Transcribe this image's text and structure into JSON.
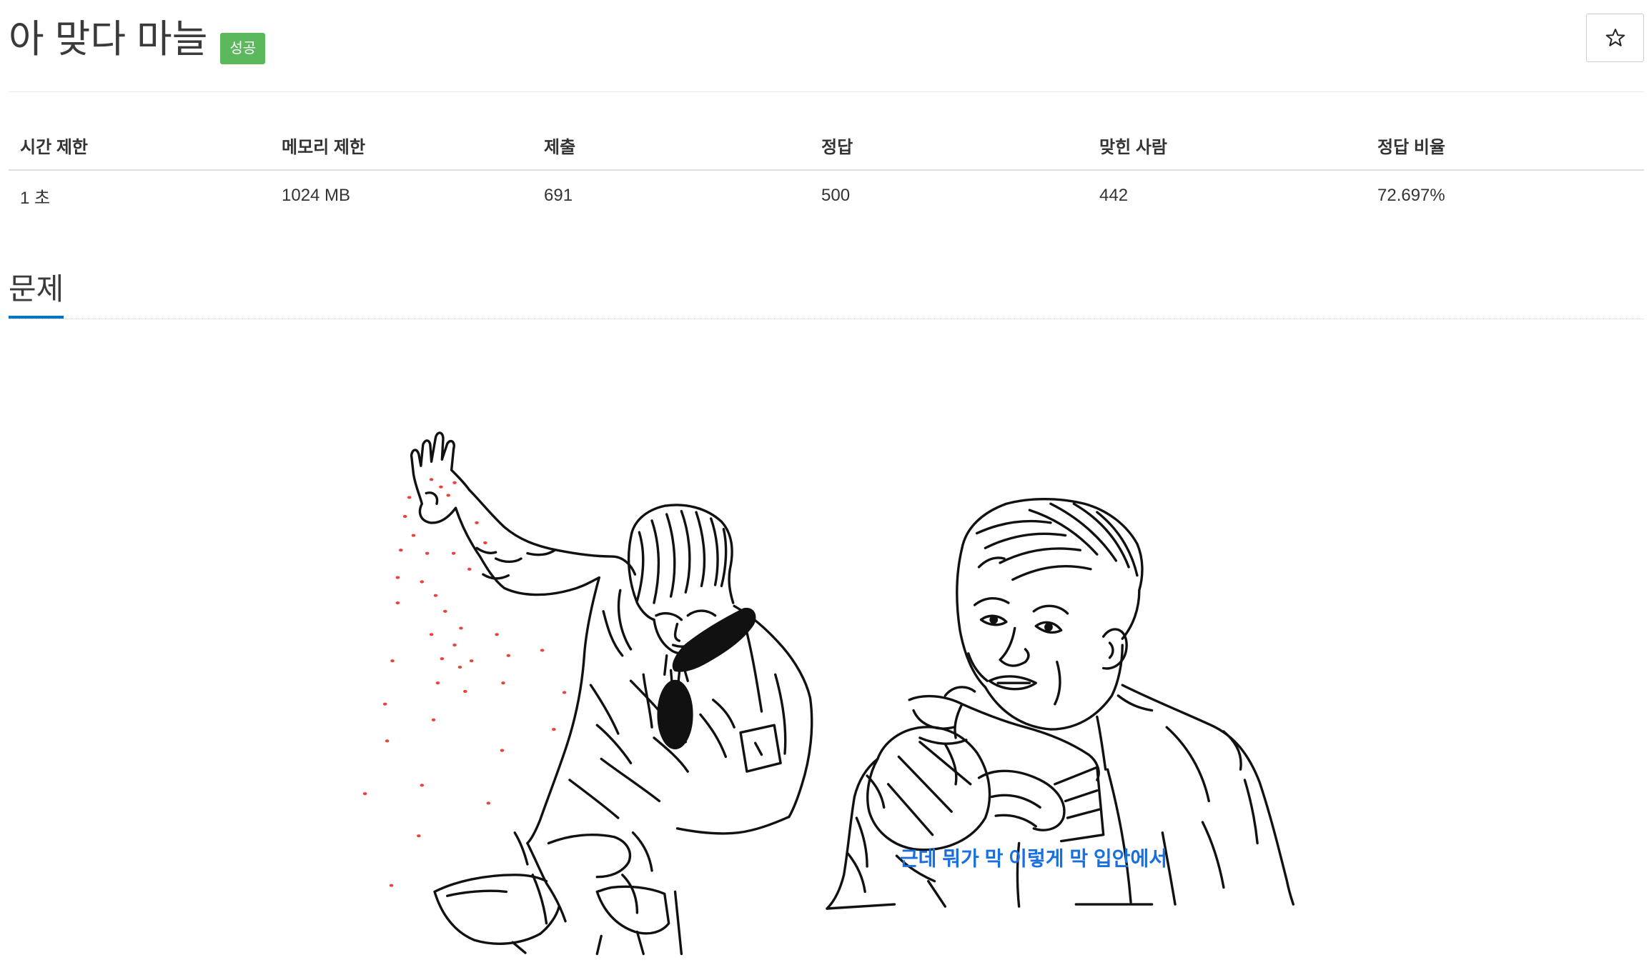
{
  "problem": {
    "title": "아 맞다 마늘",
    "status_badge": "성공",
    "favorite_icon": "star-icon"
  },
  "stats_table": {
    "headers": [
      "시간 제한",
      "메모리 제한",
      "제출",
      "정답",
      "맞힌 사람",
      "정답 비율"
    ],
    "values": [
      "1 초",
      "1024 MB",
      "691",
      "500",
      "442",
      "72.697%"
    ]
  },
  "section": {
    "heading": "문제"
  },
  "illustration": {
    "caption": "근데 뭐가 막 이렇게 막 입안에서"
  },
  "colors": {
    "badge_bg": "#5cb85c",
    "accent_blue": "#0076c0",
    "caption_blue": "#1a6fe0",
    "salt_red": "#e8443a",
    "text": "#333333"
  }
}
